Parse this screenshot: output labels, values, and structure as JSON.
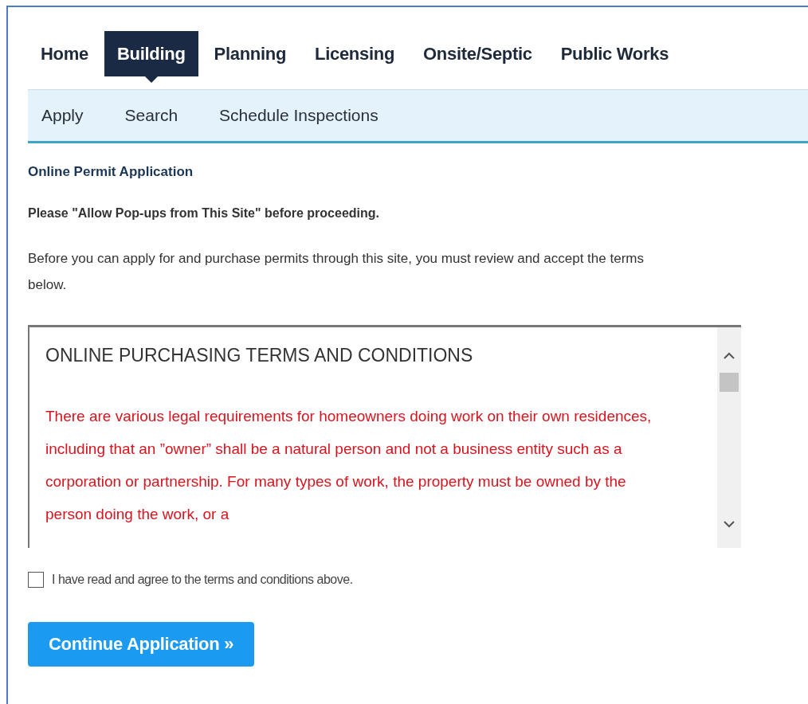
{
  "tabs": [
    {
      "label": "Home",
      "selected": false
    },
    {
      "label": "Building",
      "selected": true
    },
    {
      "label": "Planning",
      "selected": false
    },
    {
      "label": "Licensing",
      "selected": false
    },
    {
      "label": "Onsite/Septic",
      "selected": false
    },
    {
      "label": "Public Works",
      "selected": false
    }
  ],
  "subnav": [
    "Apply",
    "Search",
    "Schedule Inspections"
  ],
  "heading": "Online Permit Application",
  "popup_notice": "Please \"Allow Pop-ups from This Site\" before proceeding.",
  "intro": "Before you can apply for and purchase permits through this site, you must review and accept the terms below.",
  "terms": {
    "title": "ONLINE PURCHASING TERMS AND CONDITIONS",
    "body": "There are various legal requirements for homeowners doing work on their own residences, including that an ”owner” shall be a natural person and not a business entity such as a corporation or partnership. For many types of work, the property must be owned by the person doing the work, or a"
  },
  "agree": {
    "label": "I have read and agree to the terms and conditions above.",
    "checked": false
  },
  "button": "Continue Application »"
}
